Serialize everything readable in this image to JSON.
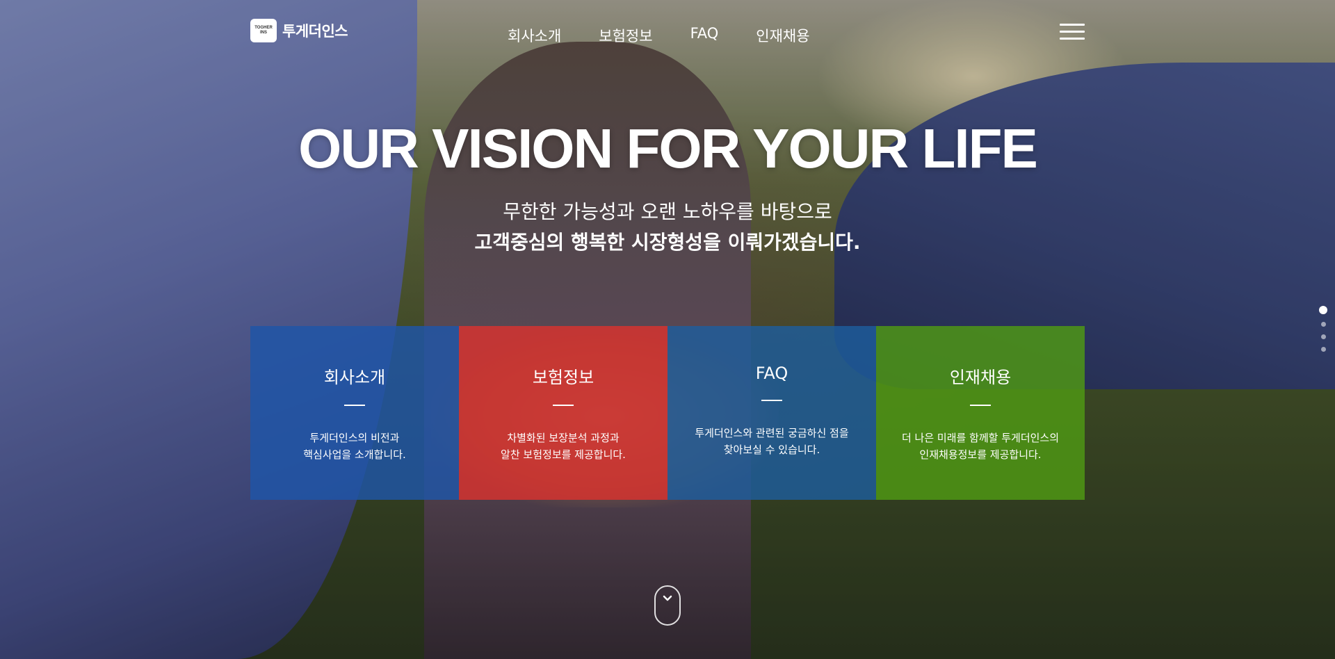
{
  "header": {
    "logo_mark_line1": "TOGHER",
    "logo_mark_line2": "INS",
    "logo_text": "투게더인스",
    "nav": [
      "회사소개",
      "보험정보",
      "FAQ",
      "인재채용"
    ]
  },
  "hero": {
    "headline": "OUR VISION FOR YOUR LIFE",
    "subline1": "무한한 가능성과 오랜 노하우를 바탕으로",
    "subline2": "고객중심의 행복한 시장형성을 이뤄가겠습니다."
  },
  "cards": [
    {
      "title": "회사소개",
      "desc1": "투게더인스의 비전과",
      "desc2": "핵심사업을 소개합니다.",
      "color": "#1e56a8"
    },
    {
      "title": "보험정보",
      "desc1": "차별화된 보장분석 과정과",
      "desc2": "알찬 보험정보를 제공합니다.",
      "color": "#d9322e"
    },
    {
      "title": "FAQ",
      "desc1": "투게더인스와 관련된 궁금하신 점을",
      "desc2": "찾아보실 수 있습니다.",
      "color": "#1d5d9c"
    },
    {
      "title": "인재채용",
      "desc1": "더 나은 미래를 함께할 투게더인스의",
      "desc2": "인재채용정보를 제공합니다.",
      "color": "#4f9a14"
    }
  ],
  "pager": {
    "count": 4,
    "active_index": 0
  },
  "icons": {
    "menu": "hamburger-icon",
    "scroll": "chevron-down-icon"
  }
}
